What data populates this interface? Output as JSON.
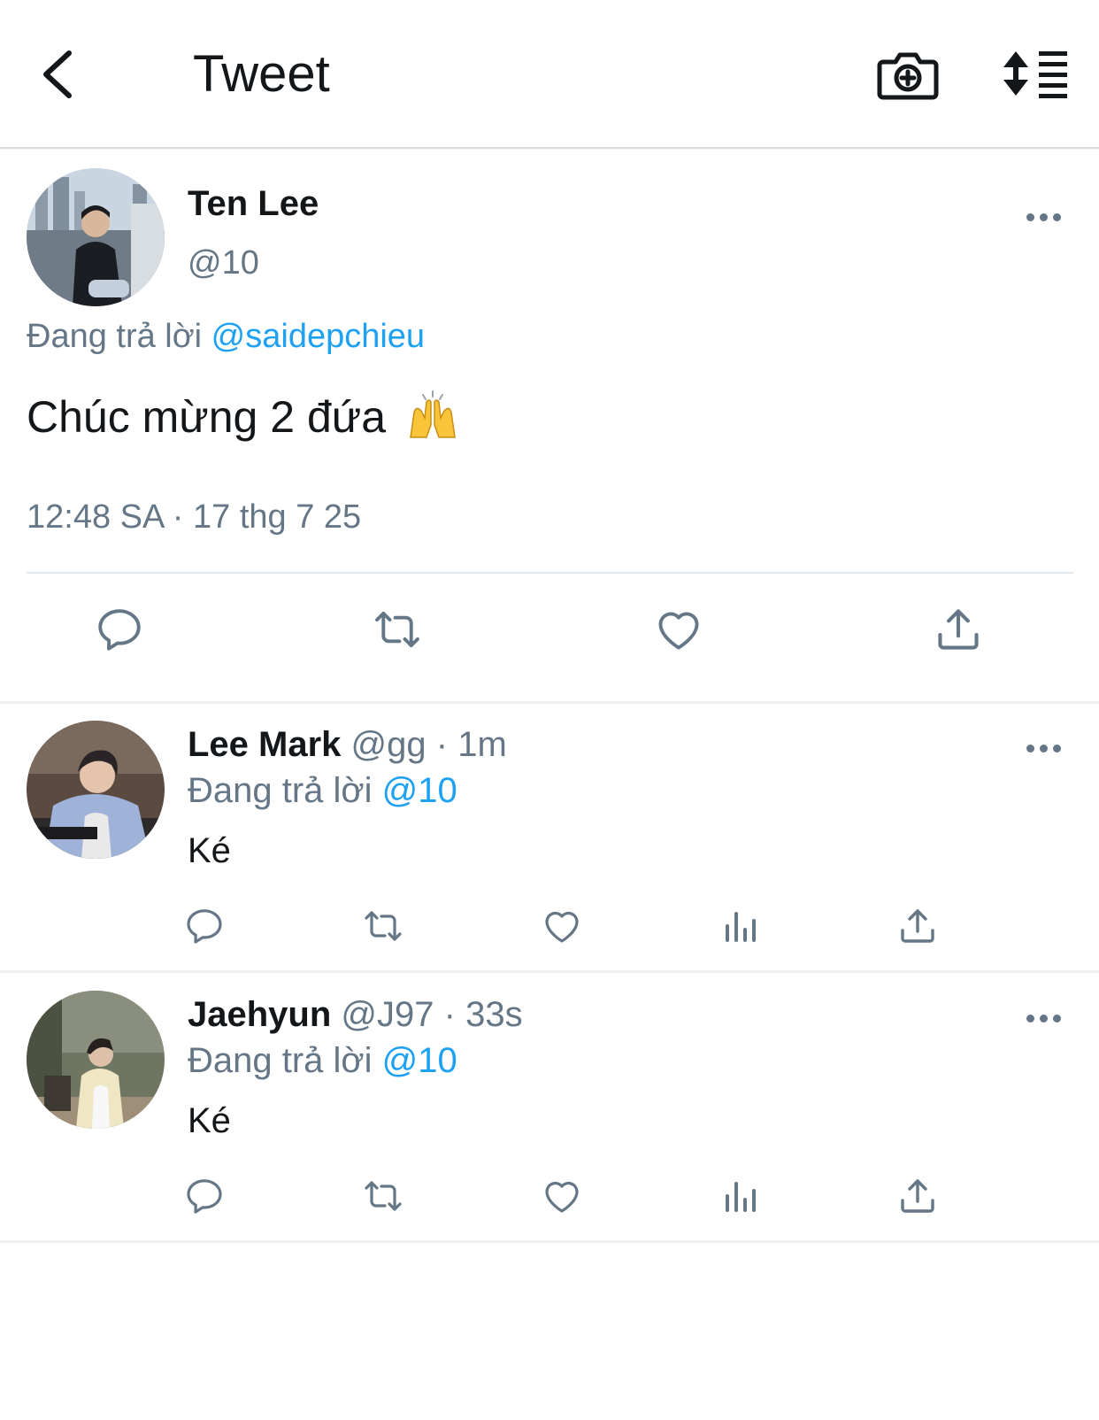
{
  "header": {
    "title": "Tweet",
    "back_icon": "chevron-left-icon",
    "camera_icon": "camera-add-icon",
    "sort_icon": "sort-list-icon"
  },
  "main_tweet": {
    "name": "Ten Lee",
    "handle": "@10",
    "replying_prefix": "Đang trả lời",
    "replying_to": "@saidepchieu",
    "text": "Chúc mừng 2 đứa",
    "emoji": "raising-hands-emoji",
    "timestamp": "12:48 SA · 17 thg 7 25",
    "actions": [
      "reply-icon",
      "retweet-icon",
      "like-icon",
      "share-icon"
    ]
  },
  "replies": [
    {
      "name": "Lee Mark",
      "handle": "@gg",
      "separator": "·",
      "time": "1m",
      "replying_prefix": "Đang trả lời",
      "replying_to": "@10",
      "text": "Ké"
    },
    {
      "name": "Jaehyun",
      "handle": "@J97",
      "separator": "·",
      "time": "33s",
      "replying_prefix": "Đang trả lời",
      "replying_to": "@10",
      "text": "Ké"
    }
  ],
  "colors": {
    "accent": "#1da1f2",
    "text": "#14171a",
    "secondary": "#657786",
    "divider": "#e1e8ed"
  }
}
